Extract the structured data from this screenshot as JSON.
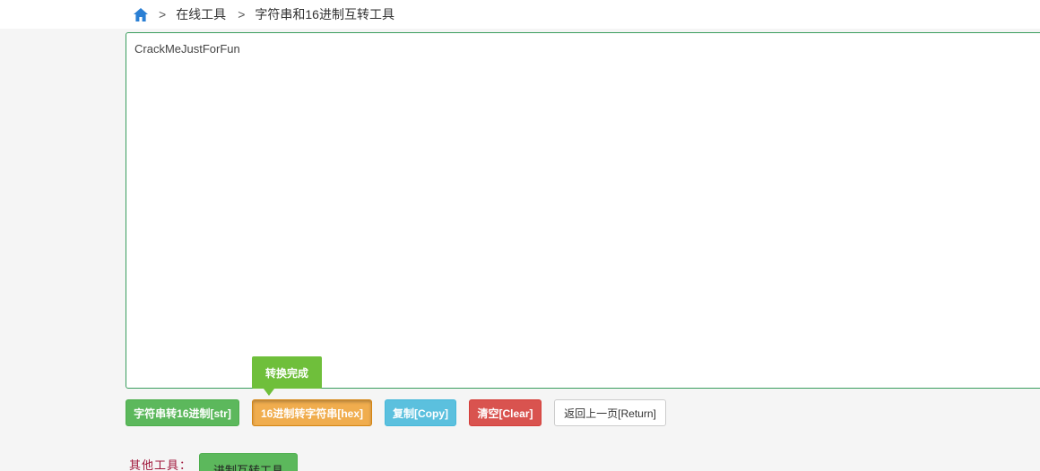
{
  "breadcrumb": {
    "home_icon": "home-icon",
    "separator": ">",
    "items": [
      "在线工具",
      "字符串和16进制互转工具"
    ]
  },
  "editor": {
    "value": "CrackMeJustForFun"
  },
  "tooltip": {
    "text": "转换完成"
  },
  "buttons": {
    "str_to_hex": "字符串转16进制[str]",
    "hex_to_str": "16进制转字符串[hex]",
    "copy": "复制[Copy]",
    "clear": "清空[Clear]",
    "return": "返回上一页[Return]"
  },
  "other_tools": {
    "label": "其他工具：",
    "items": [
      "进制互转工具"
    ]
  },
  "colors": {
    "accent_green": "#5cb85c",
    "accent_orange": "#f0ad4e",
    "accent_blue": "#5bc0de",
    "accent_red": "#d9534f",
    "tooltip_green": "#6fbf3b",
    "home_icon_blue": "#2a7fd4"
  }
}
